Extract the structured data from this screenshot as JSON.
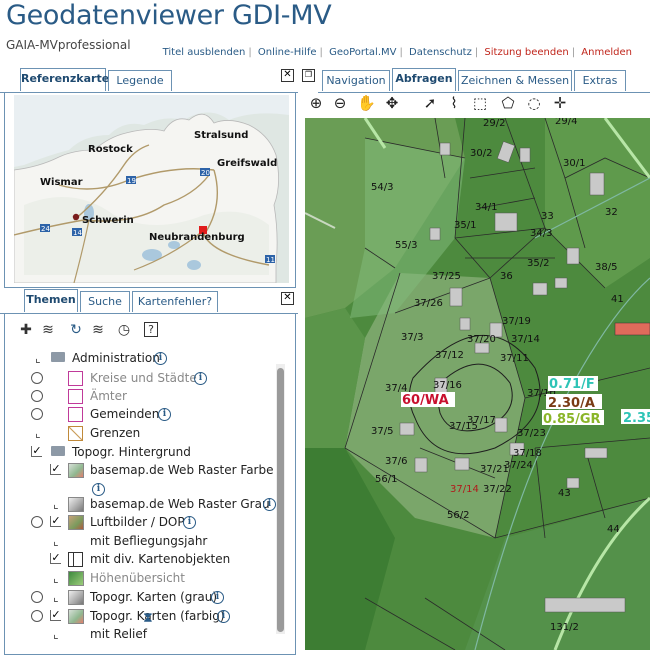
{
  "app": {
    "title": "Geodatenviewer GDI-MV",
    "subtitle": "GAIA-MVprofessional"
  },
  "toplinks": [
    {
      "label": "Titel ausblenden",
      "color": "#2a5b86"
    },
    {
      "label": "Online-Hilfe",
      "color": "#2a5b86"
    },
    {
      "label": "GeoPortal.MV",
      "color": "#2a5b86"
    },
    {
      "label": "Datenschutz",
      "color": "#2a5b86"
    },
    {
      "label": "Sitzung beenden",
      "color": "#c0261c"
    },
    {
      "label": "Anmelden",
      "color": "#c0261c"
    }
  ],
  "left_top_tabs": {
    "referenzkarte": "Referenzkarte",
    "legende": "Legende"
  },
  "refmap": {
    "cities": {
      "rostock": "Rostock",
      "stralsund": "Stralsund",
      "greifswald": "Greifswald",
      "wismar": "Wismar",
      "schwerin": "Schwerin",
      "neubrandenburg": "Neubrandenburg"
    },
    "roads": {
      "r19": "19",
      "r20": "20",
      "r14": "14",
      "r24": "24",
      "r11": "11"
    }
  },
  "left_bottom_tabs": {
    "themen": "Themen",
    "suche": "Suche",
    "kartenfehler": "Kartenfehler?"
  },
  "tree": {
    "administration": "Administration",
    "kreise": "Kreise und Städte",
    "aemter": "Ämter",
    "gemeinden": "Gemeinden",
    "grenzen": "Grenzen",
    "topogr_hintergrund": "Topogr. Hintergrund",
    "basemap_farbe": "basemap.de Web Raster Farbe",
    "basemap_grau": "basemap.de Web Raster Grau",
    "luftbilder": "Luftbilder / DOP",
    "befliegung": "mit Befliegungsjahr",
    "kartenobjekte": "mit div. Kartenobjekten",
    "hoehen": "Höhenübersicht",
    "topo_grau": "Topogr. Karten (grau)",
    "topo_farbig": "Topogr. Karten (farbig)",
    "relief": "mit Relief"
  },
  "right_tabs": {
    "navigation": "Navigation",
    "abfragen": "Abfragen",
    "zeichnen": "Zeichnen & Messen",
    "extras": "Extras"
  },
  "parcels": {
    "p29_2": "29/2",
    "p29_4": "29/4",
    "p30_2": "30/2",
    "p30_1": "30/1",
    "p54_3": "54/3",
    "p34_1": "34/1",
    "p33": "33",
    "p32": "32",
    "p35_1": "35/1",
    "p34_3": "34/3",
    "p55_3": "55/3",
    "p35_2": "35/2",
    "p38_5": "38/5",
    "p37_25": "37/25",
    "p36": "36",
    "p41": "41",
    "p37_26": "37/26",
    "p37_19": "37/19",
    "p37_3": "37/3",
    "p37_20": "37/20",
    "p37_14": "37/14",
    "p37_12": "37/12",
    "p37_11": "37/11",
    "p37_4": "37/4",
    "p37_16": "37/16",
    "p37_10": "37/10",
    "p37_17": "37/17",
    "p37_15": "37/15",
    "p37_5": "37/5",
    "p37_23": "37/23",
    "p37_18": "37/18",
    "p37_6": "37/6",
    "p37_21": "37/21",
    "p37_24": "37/24",
    "p56_1": "56/1",
    "p37_14b": "37/14",
    "p37_22": "37/22",
    "p43": "43",
    "p56_2": "56/2",
    "p44": "44",
    "p131_2": "131/2"
  },
  "zoning": {
    "wa": "60/WA",
    "f": "0.71/F",
    "a": "2.30/A",
    "gr": "0.85/GR",
    "p235": "2.35"
  }
}
